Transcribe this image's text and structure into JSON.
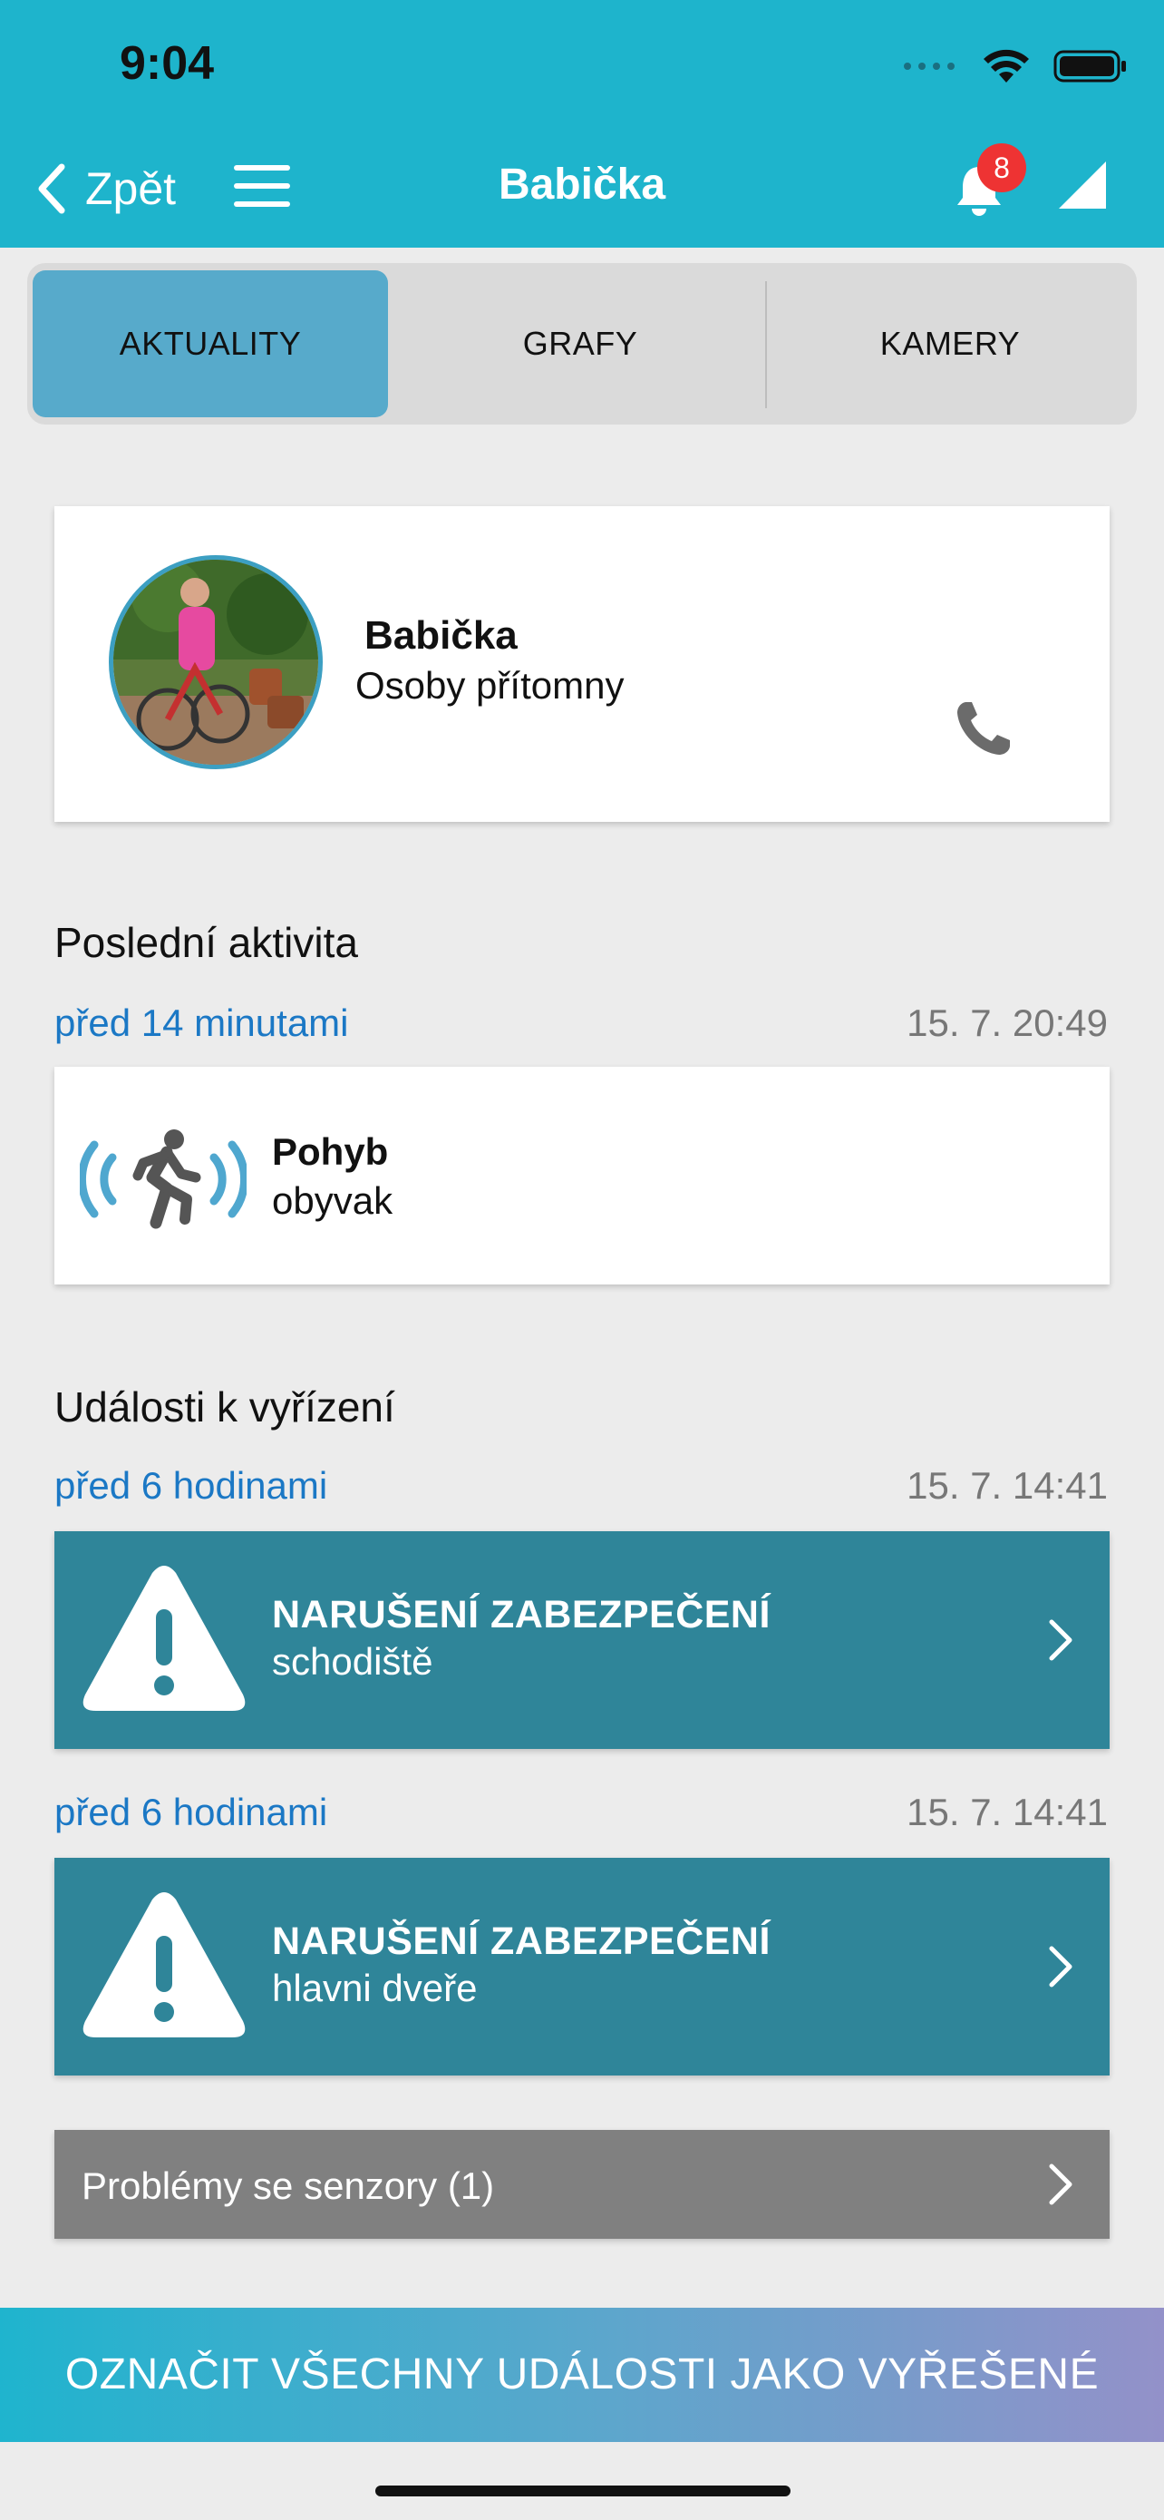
{
  "status_bar": {
    "time": "9:04"
  },
  "header": {
    "back_label": "Zpět",
    "title": "Babička",
    "notification_count": "8"
  },
  "tabs": [
    {
      "label": "AKTUALITY",
      "active": true
    },
    {
      "label": "GRAFY",
      "active": false
    },
    {
      "label": "KAMERY",
      "active": false
    }
  ],
  "profile": {
    "name": "Babička",
    "status": "Osoby přítomny"
  },
  "last_activity": {
    "section_title": "Poslední aktivita",
    "relative_time": "před 14 minutami",
    "timestamp": "15. 7. 20:49",
    "type": "Pohyb",
    "room": "obyvak"
  },
  "pending_events": {
    "section_title": "Události k vyřízení",
    "items": [
      {
        "relative_time": "před 6 hodinami",
        "timestamp": "15. 7. 14:41",
        "title": "NARUŠENÍ ZABEZPEČENÍ",
        "location": "schodiště"
      },
      {
        "relative_time": "před 6 hodinami",
        "timestamp": "15. 7. 14:41",
        "title": "NARUŠENÍ ZABEZPEČENÍ",
        "location": "hlavni dveře"
      }
    ]
  },
  "sensor_problems": {
    "label": "Problémy se senzory (1)"
  },
  "resolve_all_button": {
    "label": "OZNAČIT VŠECHNY UDÁLOSTI JAKO VYŘEŠENÉ"
  },
  "colors": {
    "header": "#1eb4cc",
    "active_tab": "#57aacb",
    "alert_card": "#2f8599",
    "link_blue": "#1b78c5",
    "notification_badge": "#ee3333"
  },
  "icons": {
    "back": "chevron-left-icon",
    "menu": "hamburger-menu-icon",
    "notifications": "bell-icon",
    "signal": "cellular-signal-icon",
    "call": "phone-icon",
    "activity": "motion-sensor-icon",
    "alert": "warning-triangle-icon",
    "open": "chevron-right-icon"
  }
}
